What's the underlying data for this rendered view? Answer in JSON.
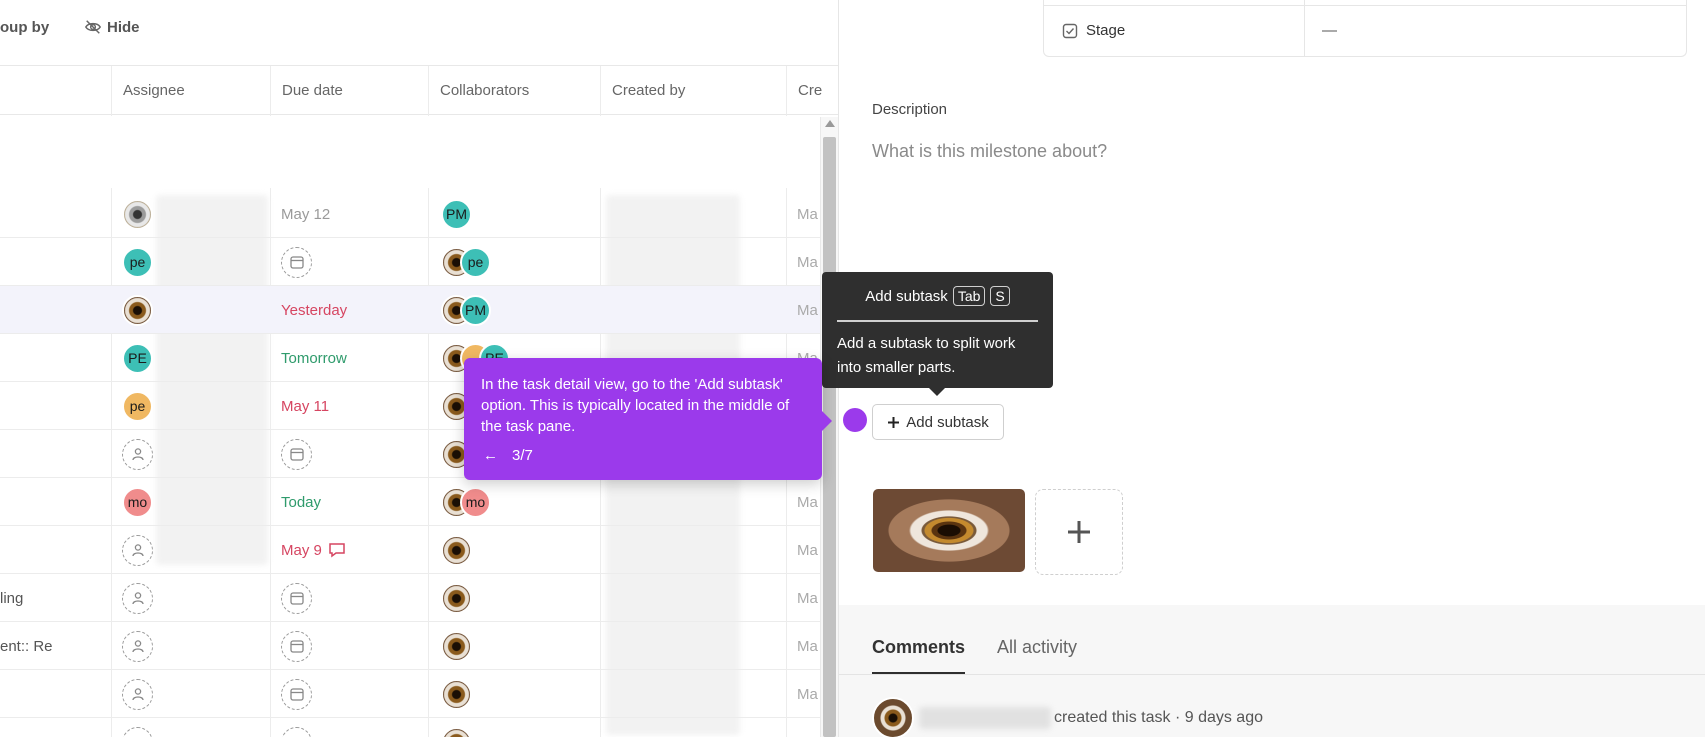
{
  "toolbar": {
    "group_by_label": "oup by",
    "hide_label": "Hide"
  },
  "table": {
    "columns": [
      "Assignee",
      "Due date",
      "Collaborators",
      "Created by",
      "Cre"
    ],
    "rows": [
      {
        "label": "",
        "due": "May 12",
        "collab": "PM",
        "created": "Ma"
      },
      {
        "label": "",
        "due": "",
        "collab": "pe",
        "created": "Ma"
      },
      {
        "label": "",
        "due": "Yesterday",
        "collab": "PM",
        "created": "Ma"
      },
      {
        "label": "",
        "due": "Tomorrow",
        "collab": "PE",
        "created": "Ma"
      },
      {
        "label": "",
        "due": "May 11",
        "collab": "",
        "created": ""
      },
      {
        "label": "",
        "due": "",
        "collab": "",
        "created": ""
      },
      {
        "label": "",
        "due": "Today",
        "collab": "mo",
        "created": "Ma"
      },
      {
        "label": "",
        "due": "May 9",
        "collab": "",
        "created": "Ma"
      },
      {
        "label": "ling",
        "due": "",
        "collab": "",
        "created": "Ma"
      },
      {
        "label": "ent:: Re",
        "due": "",
        "collab": "",
        "created": "Ma"
      },
      {
        "label": "",
        "due": "",
        "collab": "",
        "created": "Ma"
      },
      {
        "label": "",
        "due": "",
        "collab": "",
        "created": "Ma"
      }
    ],
    "assignee_initials": {
      "row2": "pe",
      "row4": "PE",
      "row5": "pe",
      "row7": "mo"
    }
  },
  "detail": {
    "stage_label": "Stage",
    "stage_value": "—",
    "description_label": "Description",
    "description_placeholder": "What is this milestone about?",
    "add_subtask_label": "Add subtask",
    "tooltip": {
      "title": "Add subtask",
      "key1": "Tab",
      "key2": "S",
      "body": "Add a subtask to split work into smaller parts."
    },
    "tabs": [
      "Comments",
      "All activity"
    ],
    "activity_text": "created this task · 9 days ago"
  },
  "guide": {
    "text": "In the task detail view, go to the 'Add subtask' option. This is typically located in the middle of the task pane.",
    "step": "3/7",
    "back_glyph": "←"
  },
  "colors": {
    "guide_purple": "#9b3aeb",
    "tooltip_dark": "#2f2f2f",
    "teal": "#3dbfb6",
    "date_red": "#d64561",
    "date_green": "#2f9b6c"
  }
}
